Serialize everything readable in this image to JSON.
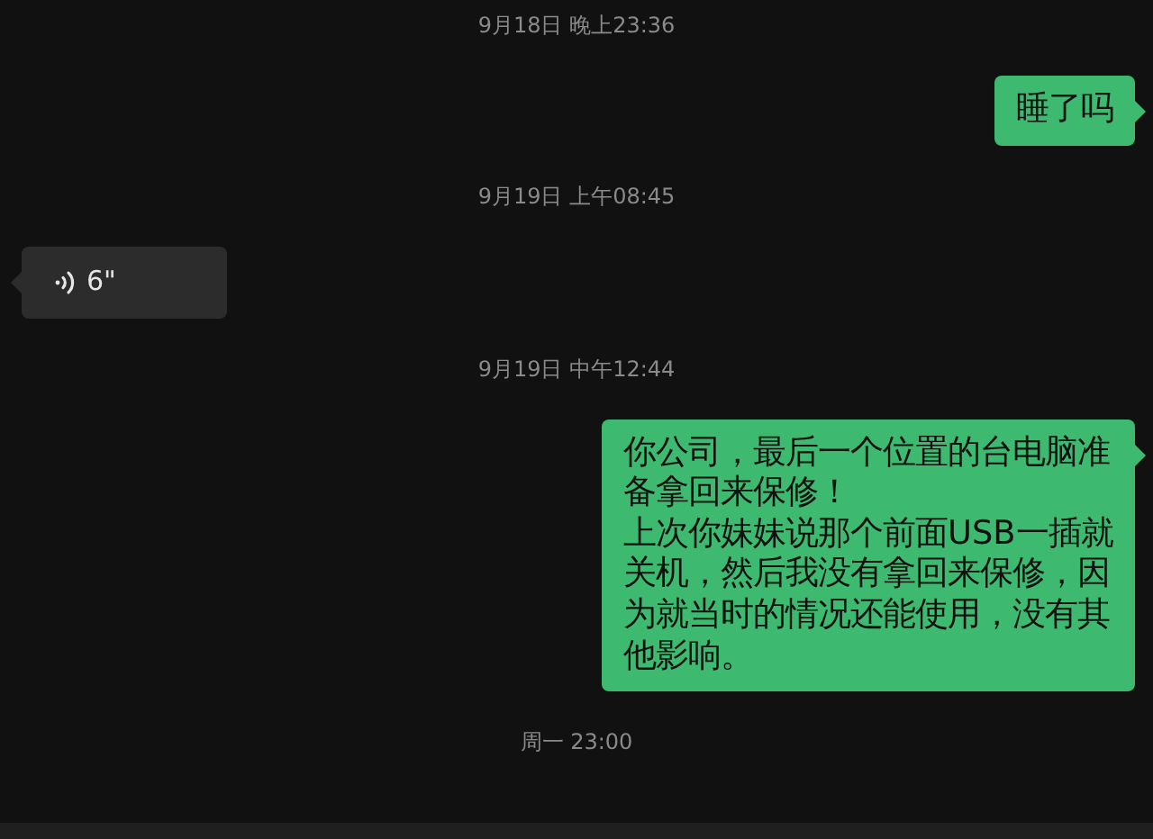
{
  "messages": [
    {
      "kind": "timestamp",
      "text": "9月18日 晚上23:36"
    },
    {
      "kind": "text",
      "outgoing": true,
      "paragraphs": [
        "睡了吗"
      ]
    },
    {
      "kind": "timestamp",
      "text": "9月19日 上午08:45"
    },
    {
      "kind": "voice",
      "outgoing": false,
      "duration": "6\""
    },
    {
      "kind": "timestamp",
      "text": "9月19日 中午12:44"
    },
    {
      "kind": "text",
      "outgoing": true,
      "paragraphs": [
        "你公司，最后一个位置的台电脑准备拿回来保修！",
        "上次你妹妹说那个前面USB一插就关机，然后我没有拿回来保修，因为就当时的情况还能使用，没有其他影响。"
      ]
    },
    {
      "kind": "timestamp",
      "text": "周一 23:00"
    }
  ]
}
